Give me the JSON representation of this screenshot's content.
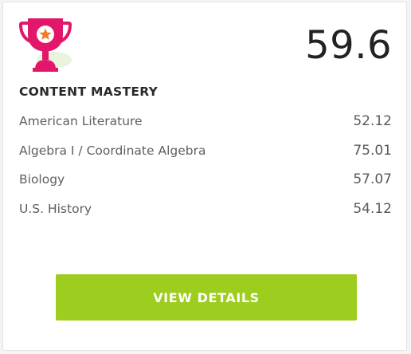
{
  "card": {
    "score": "59.6",
    "title": "CONTENT MASTERY",
    "icon": "trophy-icon",
    "accent_color": "#e3176a",
    "star_color": "#f07c2a",
    "items": [
      {
        "label": "American Literature",
        "value": "52.12"
      },
      {
        "label": "Algebra I / Coordinate Algebra",
        "value": "75.01"
      },
      {
        "label": "Biology",
        "value": "57.07"
      },
      {
        "label": "U.S. History",
        "value": "54.12"
      }
    ],
    "button_label": "VIEW DETAILS",
    "button_color": "#9ccd1f"
  }
}
